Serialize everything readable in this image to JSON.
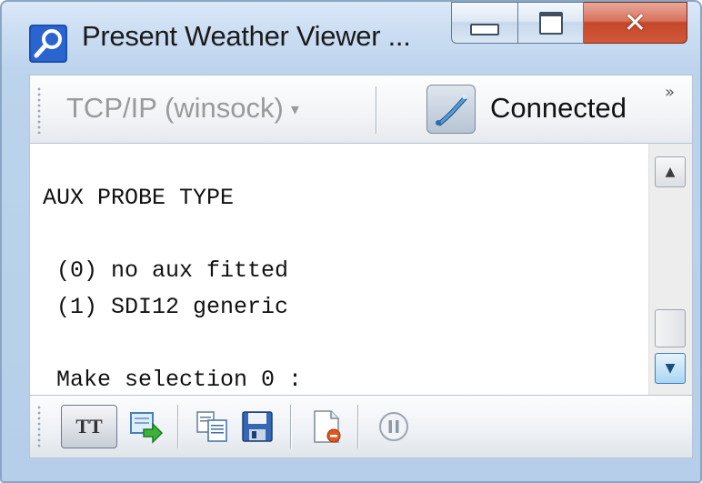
{
  "window": {
    "title": "Present Weather Viewer ...",
    "app_icon": "magnifier-icon",
    "caption_buttons": [
      "minimize-icon",
      "maximize-icon",
      "close-icon"
    ]
  },
  "toolbar_top": {
    "connection_type": "TCP/IP (winsock)",
    "connection_status": "Connected",
    "overflow_chevron": "»",
    "status_icon": "connection-status-icon"
  },
  "terminal": {
    "lines": [
      "AUX PROBE TYPE",
      "",
      " (0) no aux fitted",
      " (1) SDI12 generic",
      "",
      " Make selection 0 :"
    ]
  },
  "toolbar_bottom": {
    "tt_label": "TT",
    "buttons": [
      "tt-toggle",
      "send-file-icon",
      "copy-icon",
      "save-icon",
      "new-log-file-icon",
      "pause-icon"
    ]
  },
  "colors": {
    "frame": "#b6cee9",
    "close_button": "#c44729",
    "text_disabled": "#9a9a9a"
  }
}
